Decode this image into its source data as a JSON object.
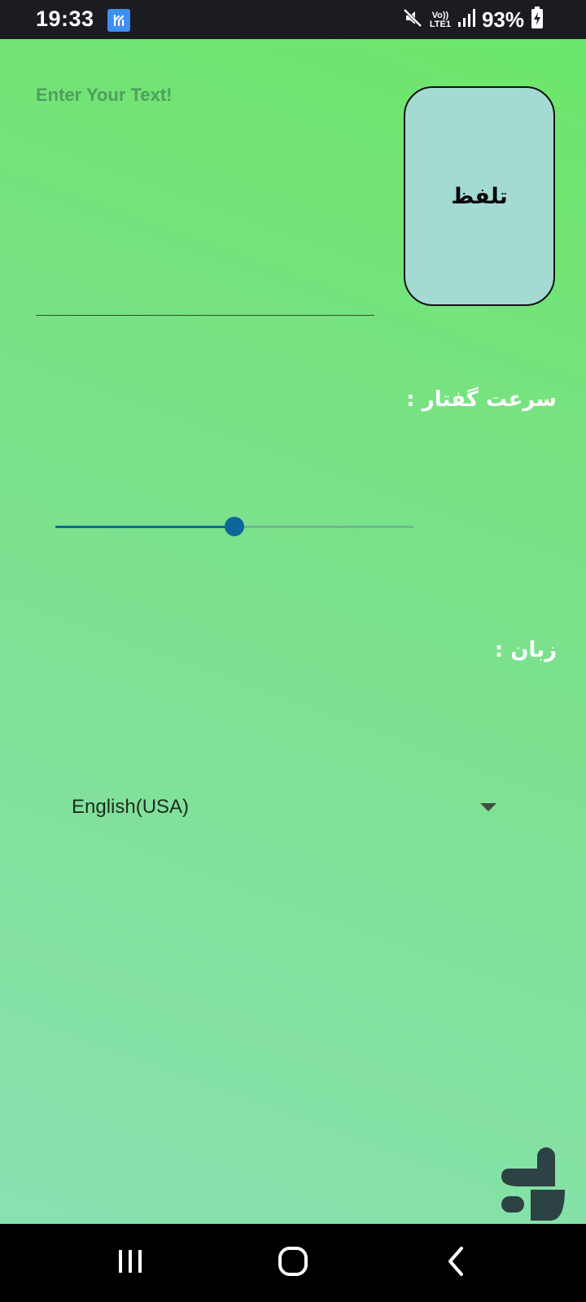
{
  "status_bar": {
    "time": "19:33",
    "lte_top": "Vo))",
    "lte_bottom": "LTE1",
    "battery_percent": "93%",
    "icons": [
      "app-notification-icon",
      "mute-icon",
      "signal-icon",
      "battery-charging-icon"
    ]
  },
  "main": {
    "text_input": {
      "placeholder": "Enter Your Text!",
      "value": ""
    },
    "speak_button_label": "تلفظ",
    "speed_label": "سرعت گفتار :",
    "speed_slider": {
      "value": 0.5
    },
    "language_label": "زبان :",
    "language_dropdown": {
      "selected": "English(USA)"
    }
  },
  "nav_bar": {
    "icons": [
      "recent-apps-icon",
      "home-icon",
      "back-icon"
    ]
  },
  "colors": {
    "status_bar_bg": "#1a1c22",
    "button_bg": "#a3dbd3",
    "slider_accent": "#0d6699",
    "gradient_top": "#6ce66a",
    "gradient_bottom": "#88e1b0"
  }
}
